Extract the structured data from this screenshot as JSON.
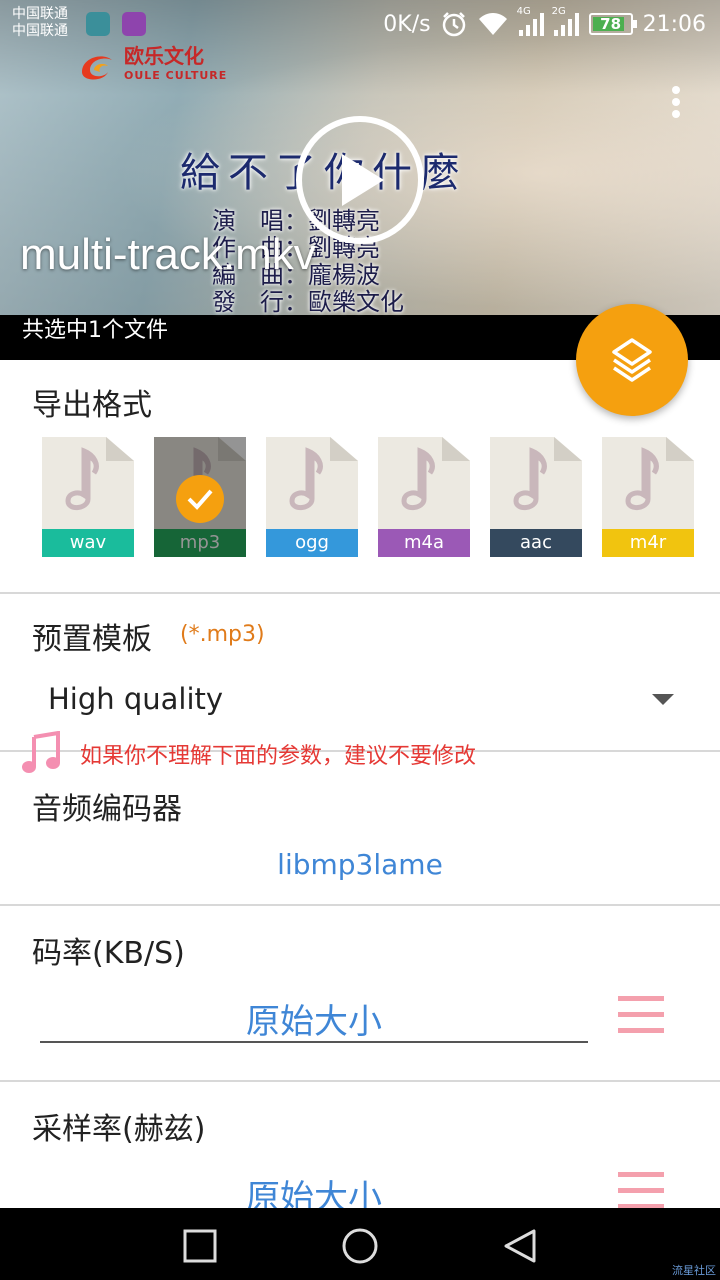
{
  "status_bar": {
    "carrier_1": "中国联通",
    "carrier_2": "中国联通",
    "net_speed": "0K/s",
    "net_type_1": "4G",
    "net_type_2": "2G",
    "battery": "78",
    "time": "21:06"
  },
  "video": {
    "logo_main": "欧乐文化",
    "logo_sub": "OULE CULTURE",
    "lyrics_title": "給不了你什麼",
    "credits": "演　唱：劉轉亮\n作　曲：劉轉亮\n編　曲：龐楊波\n發　行：歐樂文化",
    "file_name": "multi-track.mkv",
    "selected_count": "共选中1个文件"
  },
  "export_format": {
    "heading": "导出格式",
    "formats": [
      {
        "label": "wav",
        "color": "#1abc9c",
        "selected": false
      },
      {
        "label": "mp3",
        "color": "#27ae60",
        "selected": true
      },
      {
        "label": "ogg",
        "color": "#3498db",
        "selected": false
      },
      {
        "label": "m4a",
        "color": "#9b59b6",
        "selected": false
      },
      {
        "label": "aac",
        "color": "#34495e",
        "selected": false
      },
      {
        "label": "m4r",
        "color": "#f1c40f",
        "selected": false
      }
    ]
  },
  "preset": {
    "heading": "预置模板",
    "hint": "(*.mp3)",
    "value": "High quality"
  },
  "warning": "如果你不理解下面的参数，建议不要修改",
  "encoder": {
    "heading": "音频编码器",
    "value": "libmp3lame"
  },
  "bitrate": {
    "heading": "码率(KB/S)",
    "value": "原始大小"
  },
  "sample_rate": {
    "heading": "采样率(赫兹)",
    "value": "原始大小"
  },
  "watermark": "流星社区",
  "colors": {
    "accent_orange": "#f5a00f",
    "value_blue": "#3f86d6",
    "warning_red": "#e53935",
    "hint_orange": "#e07b1a",
    "list_icon_pink": "#f4a0ad"
  }
}
